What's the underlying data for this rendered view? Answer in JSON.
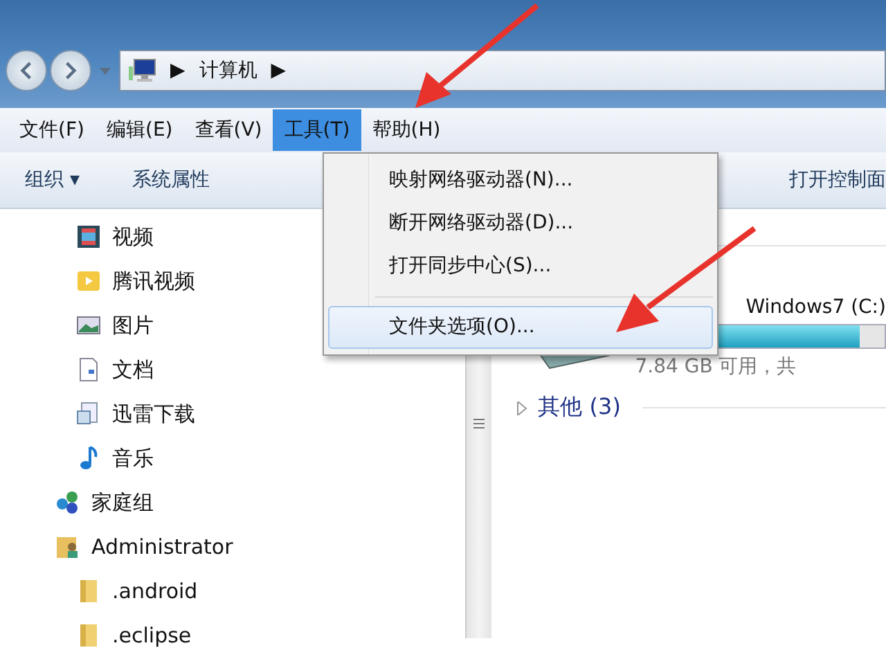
{
  "address": {
    "crumbs": [
      {
        "label": "▶"
      },
      {
        "label": "计算机"
      },
      {
        "label": "▶"
      }
    ]
  },
  "menu_bar": [
    {
      "label": "文件(F)",
      "selected": false
    },
    {
      "label": "编辑(E)",
      "selected": false
    },
    {
      "label": "查看(V)",
      "selected": false
    },
    {
      "label": "工具(T)",
      "selected": true
    },
    {
      "label": "帮助(H)",
      "selected": false
    }
  ],
  "toolbar": [
    {
      "label": "组织 ▾"
    },
    {
      "label": "系统属性"
    },
    {
      "label": "打开控制面"
    }
  ],
  "dropdown": [
    {
      "kind": "item",
      "label": "映射网络驱动器(N)...",
      "selected": false
    },
    {
      "kind": "item",
      "label": "断开网络驱动器(D)...",
      "selected": false
    },
    {
      "kind": "item",
      "label": "打开同步中心(S)...",
      "selected": false
    },
    {
      "kind": "separator"
    },
    {
      "kind": "item",
      "label": "文件夹选项(O)...",
      "selected": true
    }
  ],
  "library_items": [
    {
      "label": "视频",
      "kind": "video"
    },
    {
      "label": "腾讯视频",
      "kind": "play"
    },
    {
      "label": "图片",
      "kind": "image"
    },
    {
      "label": "文档",
      "kind": "document"
    },
    {
      "label": "迅雷下载",
      "kind": "download"
    },
    {
      "label": "音乐",
      "kind": "music"
    }
  ],
  "tree": [
    {
      "label": "家庭组",
      "kind": "homegroup"
    },
    {
      "label": "Administrator",
      "kind": "user",
      "children": [
        {
          "label": ".android",
          "kind": "folder"
        },
        {
          "label": ".eclipse",
          "kind": "folder"
        }
      ]
    }
  ],
  "drive": {
    "name": "Windows7 (C:)",
    "level": 0.9,
    "free": "7.84 GB 可用，共"
  },
  "group": {
    "label": "其他 (3)",
    "expanded": false
  }
}
